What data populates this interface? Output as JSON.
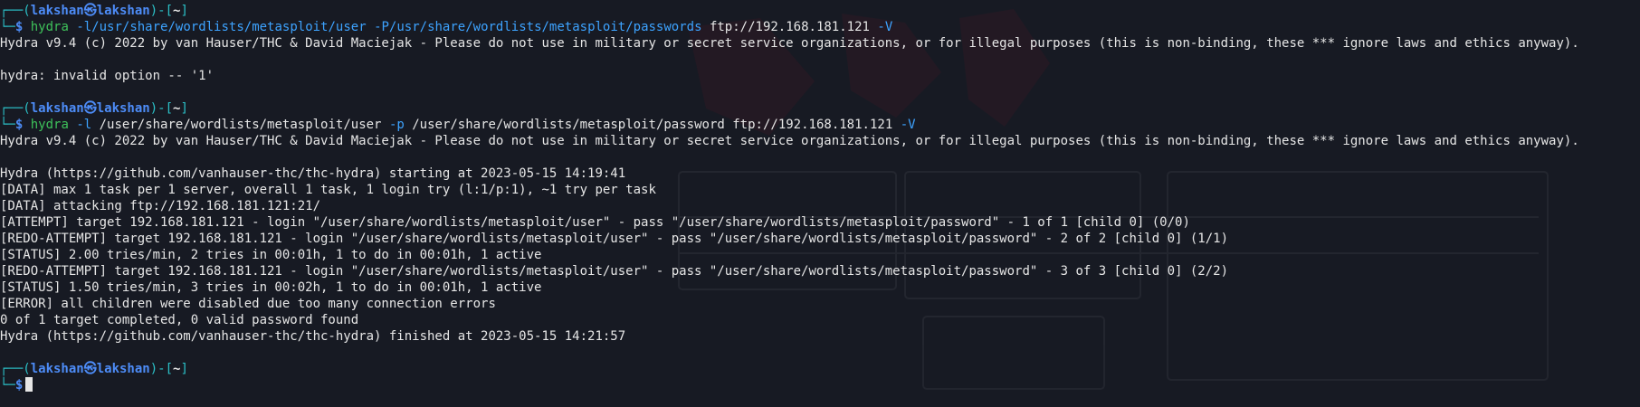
{
  "theme": {
    "background": "#171a23",
    "prompt_color": "#2bc1c8",
    "user_color": "#4d8cf7",
    "command_color": "#3ec15a",
    "text_color": "#e6e6e6"
  },
  "prompt": {
    "user_host": "lakshan㉿lakshan",
    "cwd": "~",
    "symbol": "$"
  },
  "commands": [
    {
      "program": "hydra",
      "args": [
        {
          "text": "-l/usr/share/wordlists/metasploit/user",
          "kind": "flag"
        },
        {
          "text": "-P/usr/share/wordlists/metasploit/passwords",
          "kind": "flag"
        },
        {
          "text": "ftp://192.168.181.121",
          "kind": "arg"
        },
        {
          "text": "-V",
          "kind": "flag"
        }
      ]
    },
    {
      "program": "hydra",
      "args": [
        {
          "text": "-l",
          "kind": "flag"
        },
        {
          "text": "/user/share/wordlists/metasploit/user",
          "kind": "arg"
        },
        {
          "text": "-p",
          "kind": "flag"
        },
        {
          "text": "/user/share/wordlists/metasploit/password",
          "kind": "arg"
        },
        {
          "text": "ftp://192.168.181.121",
          "kind": "arg"
        },
        {
          "text": "-V",
          "kind": "flag"
        }
      ]
    }
  ],
  "output": {
    "banner": "Hydra v9.4 (c) 2022 by van Hauser/THC & David Maciejak - Please do not use in military or secret service organizations, or for illegal purposes (this is non-binding, these *** ignore laws and ethics anyway).",
    "error_invalid": "hydra: invalid option -- '1'",
    "lines": [
      "Hydra (https://github.com/vanhauser-thc/thc-hydra) starting at 2023-05-15 14:19:41",
      "[DATA] max 1 task per 1 server, overall 1 task, 1 login try (l:1/p:1), ~1 try per task",
      "[DATA] attacking ftp://192.168.181.121:21/",
      "[ATTEMPT] target 192.168.181.121 - login \"/user/share/wordlists/metasploit/user\" - pass \"/user/share/wordlists/metasploit/password\" - 1 of 1 [child 0] (0/0)",
      "[REDO-ATTEMPT] target 192.168.181.121 - login \"/user/share/wordlists/metasploit/user\" - pass \"/user/share/wordlists/metasploit/password\" - 2 of 2 [child 0] (1/1)",
      "[STATUS] 2.00 tries/min, 2 tries in 00:01h, 1 to do in 00:01h, 1 active",
      "[REDO-ATTEMPT] target 192.168.181.121 - login \"/user/share/wordlists/metasploit/user\" - pass \"/user/share/wordlists/metasploit/password\" - 3 of 3 [child 0] (2/2)",
      "[STATUS] 1.50 tries/min, 3 tries in 00:02h, 1 to do in 00:01h, 1 active",
      "[ERROR] all children were disabled due too many connection errors",
      "0 of 1 target completed, 0 valid password found",
      "Hydra (https://github.com/vanhauser-thc/thc-hydra) finished at 2023-05-15 14:21:57"
    ]
  }
}
